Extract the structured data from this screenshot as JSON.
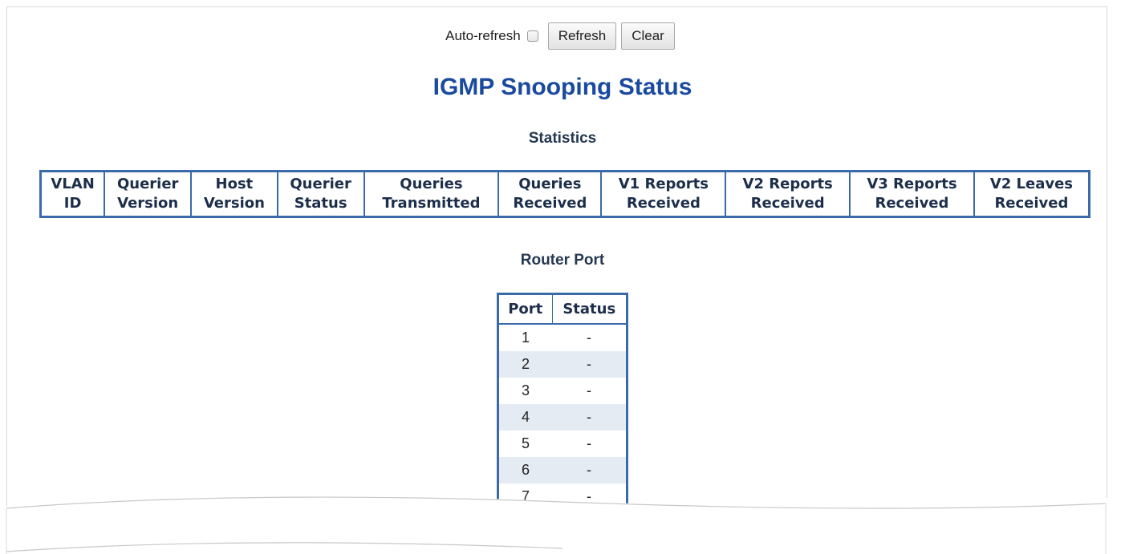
{
  "toolbar": {
    "auto_refresh_label": "Auto-refresh",
    "refresh_label": "Refresh",
    "clear_label": "Clear"
  },
  "page_title": "IGMP Snooping Status",
  "statistics": {
    "heading": "Statistics",
    "columns": [
      "VLAN\nID",
      "Querier\nVersion",
      "Host\nVersion",
      "Querier\nStatus",
      "Queries\nTransmitted",
      "Queries\nReceived",
      "V1 Reports\nReceived",
      "V2 Reports\nReceived",
      "V3 Reports\nReceived",
      "V2 Leaves\nReceived"
    ]
  },
  "router_port": {
    "heading": "Router Port",
    "columns": [
      "Port",
      "Status"
    ],
    "rows": [
      {
        "port": "1",
        "status": "-"
      },
      {
        "port": "2",
        "status": "-"
      },
      {
        "port": "3",
        "status": "-"
      },
      {
        "port": "4",
        "status": "-"
      },
      {
        "port": "5",
        "status": "-"
      },
      {
        "port": "6",
        "status": "-"
      },
      {
        "port": "7",
        "status": "-"
      }
    ]
  }
}
